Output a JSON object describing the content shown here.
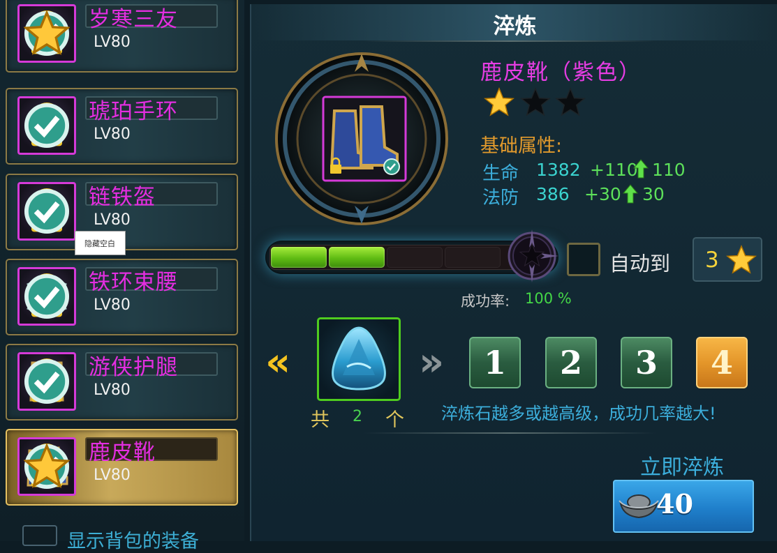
{
  "equipment_list": [
    {
      "name": "岁寒三友",
      "level": "LV80",
      "starred": true
    },
    {
      "name": "琥珀手环",
      "level": "LV80",
      "starred": false
    },
    {
      "name": "链铁盔",
      "level": "LV80",
      "starred": false
    },
    {
      "name": "铁环束腰",
      "level": "LV80",
      "starred": false
    },
    {
      "name": "游侠护腿",
      "level": "LV80",
      "starred": false
    },
    {
      "name": "鹿皮靴",
      "level": "LV80",
      "starred": true,
      "selected": true
    }
  ],
  "tooltip": "隐藏空白",
  "show_bag_label": "显示背包的装备",
  "panel": {
    "title": "淬炼",
    "item_name": "鹿皮靴（紫色）",
    "stars_filled": 1,
    "stars_total": 3,
    "attributes_title": "基础属性:",
    "stats": [
      {
        "name": "生命",
        "value": "1382",
        "bonus": "+110",
        "gain": "110"
      },
      {
        "name": "法防",
        "value": "386",
        "bonus": "+30",
        "gain": "30"
      }
    ],
    "progress_segments_filled": 2,
    "progress_segments_total": 4,
    "auto_label": "自动到",
    "target_stars": "3",
    "success_rate_label": "成功率:",
    "success_rate_value": "100 %",
    "stone_count_prefix": "共",
    "stone_count": "2",
    "stone_count_suffix": "个",
    "quantity_buttons": [
      "1",
      "2",
      "3",
      "4"
    ],
    "selected_quantity": "4",
    "hint": "淬炼石越多或越高级，成功几率越大!",
    "refine_now_label": "立即淬炼",
    "cost": "40"
  },
  "colors": {
    "item_name": "#e63de3",
    "attr_title": "#e29a2c",
    "stat_name": "#3caedb",
    "stat_value": "#3bd3cf",
    "stat_bonus": "#5de05a",
    "progress_fill": "#7fd424",
    "selected_gold": "#e4962a"
  }
}
